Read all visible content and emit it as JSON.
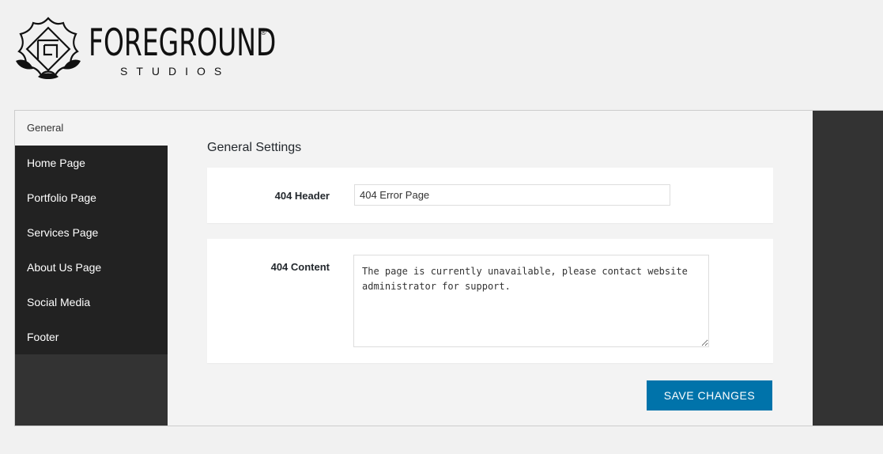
{
  "brand": {
    "name": "FOREGROUND",
    "registered": "®",
    "sub": "STUDIOS"
  },
  "sidebar": {
    "items": [
      {
        "label": "General",
        "active": true
      },
      {
        "label": "Home Page"
      },
      {
        "label": "Portfolio Page"
      },
      {
        "label": "Services Page"
      },
      {
        "label": "About Us Page"
      },
      {
        "label": "Social Media"
      },
      {
        "label": "Footer"
      }
    ]
  },
  "main": {
    "title": "General Settings",
    "header_field": {
      "label": "404 Header",
      "value": "404 Error Page"
    },
    "content_field": {
      "label": "404 Content",
      "value": "The page is currently unavailable, please contact website administrator for support."
    },
    "save_label": "SAVE CHANGES"
  },
  "colors": {
    "accent": "#0073aa",
    "sidebar_bg": "#222222",
    "dark_panel": "#333333"
  }
}
